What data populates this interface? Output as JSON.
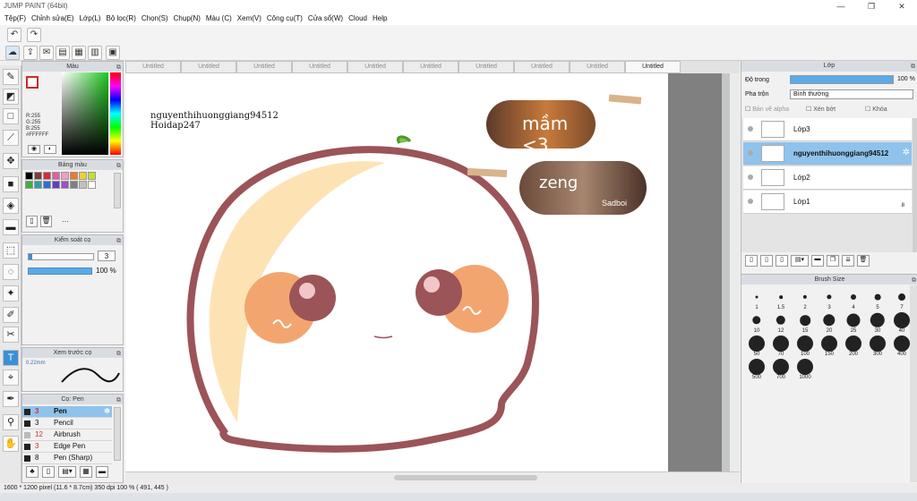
{
  "window": {
    "title": "JUMP PAINT (64bit)",
    "minimize": "—",
    "maximize": "❐",
    "close": "✕"
  },
  "menu": [
    "Tệp(F)",
    "Chỉnh sửa(E)",
    "Lớp(L)",
    "Bộ lọc(R)",
    "Chọn(S)",
    "Chụp(N)",
    "Màu (C)",
    "Xem(V)",
    "Công cụ(T)",
    "Cửa sổ(W)",
    "Cloud",
    "Help"
  ],
  "color_panel": {
    "title": "Màu",
    "values": [
      "R:255",
      "G:255",
      "B:255",
      "#FFFFFF"
    ]
  },
  "palette_panel": {
    "title": "Bảng màu",
    "more": "···"
  },
  "brush_control": {
    "title": "Kiểm soát cọ",
    "size": "3",
    "opacity": "100 %"
  },
  "brush_preview": {
    "title": "Xem trước cọ",
    "size": "0.22mm"
  },
  "brush_list": {
    "title": "Cọ: Pen",
    "items": [
      {
        "num": "3",
        "name": "Pen"
      },
      {
        "num": "3",
        "name": "Pencil"
      },
      {
        "num": "12",
        "name": "Airbrush"
      },
      {
        "num": "3",
        "name": "Edge Pen"
      },
      {
        "num": "8",
        "name": "Pen (Sharp)"
      }
    ]
  },
  "tabs": [
    "Untitled",
    "Untitled",
    "Untitled",
    "Untitled",
    "Untitled",
    "Untitled",
    "Untitled",
    "Untitled",
    "Untitled",
    "Untitled"
  ],
  "canvas_text": {
    "line1": "nguyenthihuonggiang94512",
    "line2": "Hoidap247",
    "sticker1": "mầm <3",
    "sticker2": "zeng",
    "sticker2_sub": "Sadboi"
  },
  "layers_panel": {
    "title": "Lớp",
    "opacity_label": "Độ trong",
    "opacity_value": "100 %",
    "opacity_fraction": 1.0,
    "blend_label": "Pha trộn",
    "blend_value": "Bình thường",
    "options": [
      "Bản vẽ alpha",
      "Xén bớt",
      "Khóa"
    ],
    "layers": [
      {
        "name": "Lớp3",
        "selected": false
      },
      {
        "name": "nguyenthihuonggiang94512",
        "selected": true
      },
      {
        "name": "Lớp2",
        "selected": false
      },
      {
        "name": "Lớp1",
        "selected": false
      }
    ],
    "layer_badge": "8"
  },
  "brush_size_panel": {
    "title": "Brush Size",
    "sizes": [
      "1",
      "1.5",
      "2",
      "3",
      "4",
      "5",
      "7",
      "10",
      "12",
      "15",
      "20",
      "25",
      "30",
      "40",
      "50",
      "70",
      "100",
      "150",
      "200",
      "300",
      "400",
      "500",
      "700",
      "1000"
    ]
  },
  "status": {
    "text": "1600 * 1200 pixel   (11.6 * 8.7cm)   350 dpi   100 %   ( 491, 445 )"
  },
  "colors": {
    "accent": "#3b8fd7",
    "outline": "#9b5458",
    "cream": "#fde3b4",
    "blush": "#f3a570"
  }
}
